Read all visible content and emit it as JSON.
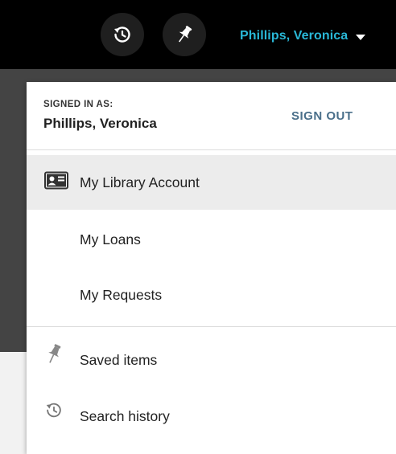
{
  "topbar": {
    "history_button": "history-icon",
    "pin_button": "pin-icon",
    "user_name": "Phillips, Veronica"
  },
  "dropdown": {
    "signed_in_label": "SIGNED IN AS:",
    "signed_in_name": "Phillips, Veronica",
    "sign_out": "SIGN OUT",
    "items": [
      {
        "label": "My Library Account",
        "icon": "id-card-icon"
      },
      {
        "label": "My Loans"
      },
      {
        "label": "My Requests"
      },
      {
        "label": "Saved items",
        "icon": "pin-icon"
      },
      {
        "label": "Search history",
        "icon": "history-icon"
      }
    ]
  },
  "colors": {
    "accent_link": "#29b7d6",
    "sign_out": "#4a6f8a",
    "topbar_bg": "#000000",
    "active_row": "#ececec"
  }
}
